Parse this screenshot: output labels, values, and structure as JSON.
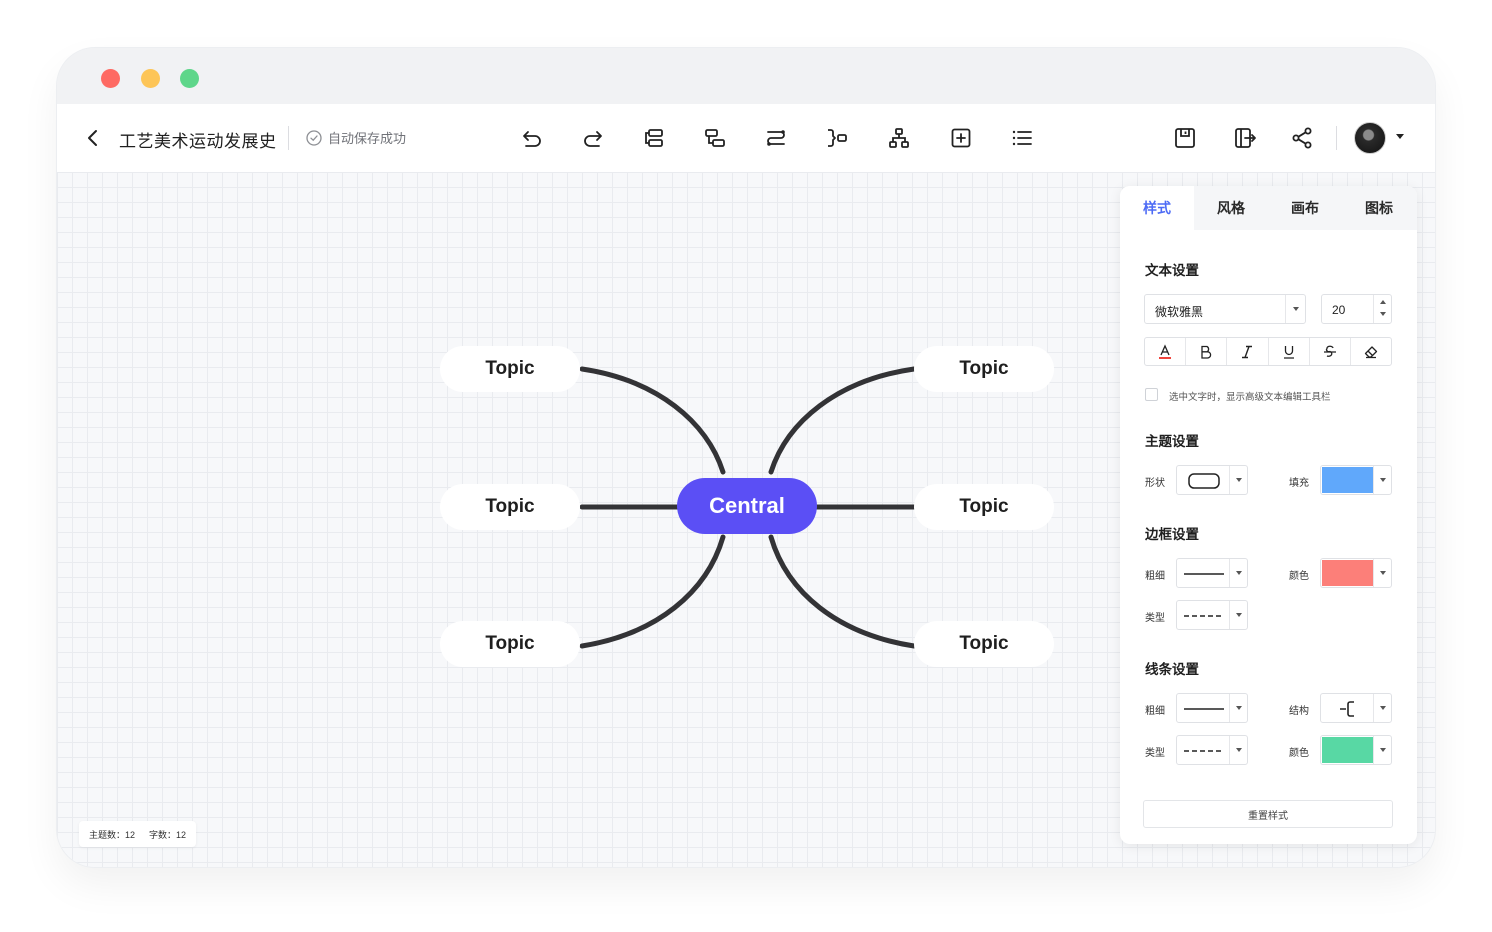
{
  "app": {
    "doc_title": "工艺美术运动发展史",
    "save_status": "自动保存成功"
  },
  "toolbar": {
    "icons": [
      "undo-icon",
      "redo-icon",
      "add-sibling-icon",
      "add-child-icon",
      "relation-line-icon",
      "summary-icon",
      "structure-icon",
      "insert-topic-icon",
      "outline-list-icon"
    ],
    "right_icons": [
      "save-icon",
      "export-icon",
      "share-icon"
    ]
  },
  "mindmap": {
    "central": "Central",
    "topics_left": [
      "Topic",
      "Topic",
      "Topic"
    ],
    "topics_right": [
      "Topic",
      "Topic",
      "Topic"
    ],
    "central_color": "#5b4ff5",
    "line_color": "#333336"
  },
  "stats": {
    "topic_count_label": "主题数：",
    "topic_count": "12",
    "word_count_label": "字数：",
    "word_count": "12"
  },
  "panel": {
    "tabs": [
      "样式",
      "风格",
      "画布",
      "图标"
    ],
    "active_tab": "样式",
    "text_settings": {
      "title": "文本设置",
      "font": "微软雅黑",
      "size": "20",
      "format_buttons": [
        "A",
        "B",
        "I",
        "U",
        "S",
        "eraser"
      ],
      "advanced_toolbar_label": "选中文字时，显示高级文本编辑工具栏"
    },
    "topic_settings": {
      "title": "主题设置",
      "shape_label": "形状",
      "fill_label": "填充",
      "fill_color": "#60a8fb"
    },
    "border_settings": {
      "title": "边框设置",
      "weight_label": "粗细",
      "color_label": "颜色",
      "type_label": "类型",
      "color": "#fc7f79"
    },
    "line_settings": {
      "title": "线条设置",
      "weight_label": "粗细",
      "structure_label": "结构",
      "type_label": "类型",
      "color_label": "颜色",
      "color": "#58d8a4"
    },
    "reset_label": "重置样式"
  }
}
